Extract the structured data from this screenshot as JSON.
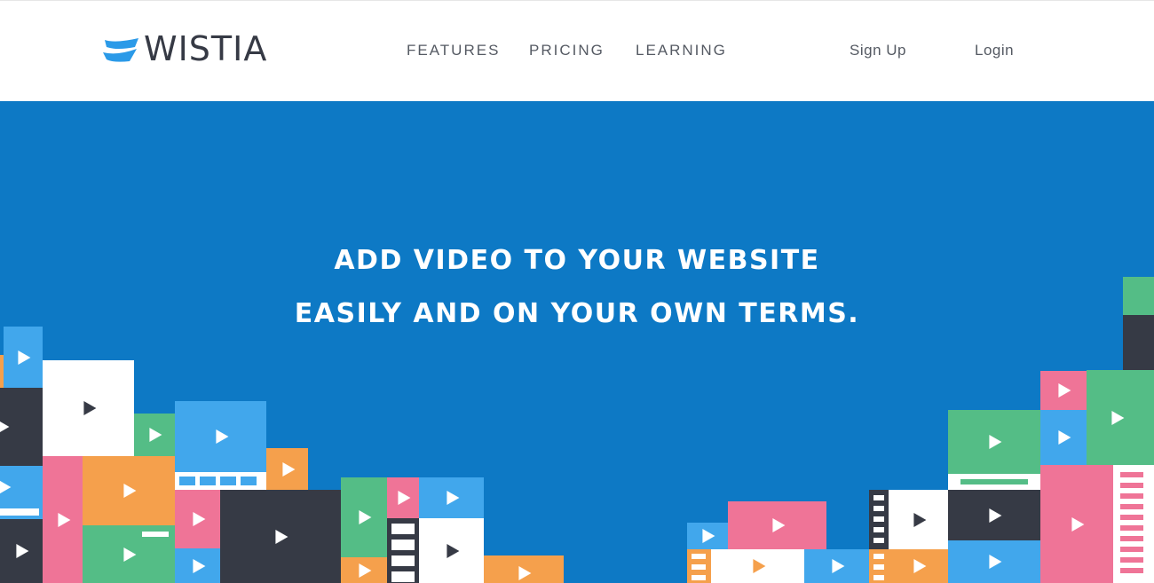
{
  "brand": {
    "name": "WISTIA",
    "logo_icon": "wistia-wave-icon",
    "colors": {
      "primary_blue": "#0d79c5",
      "logo_blue": "#2b9ae8",
      "text_dark": "#363a45"
    }
  },
  "nav": {
    "features": "FEATURES",
    "pricing": "PRICING",
    "learning": "LEARNING",
    "signup": "Sign Up",
    "login": "Login"
  },
  "hero": {
    "headline_line1": "ADD VIDEO TO YOUR WEBSITE",
    "headline_line2": "EASILY AND ON YOUR OWN TERMS.",
    "illustration_icon": "play-icon",
    "tile_colors": [
      "#41a7ec",
      "#363a45",
      "#ffffff",
      "#54bd86",
      "#f5a04c",
      "#ef7497"
    ]
  }
}
